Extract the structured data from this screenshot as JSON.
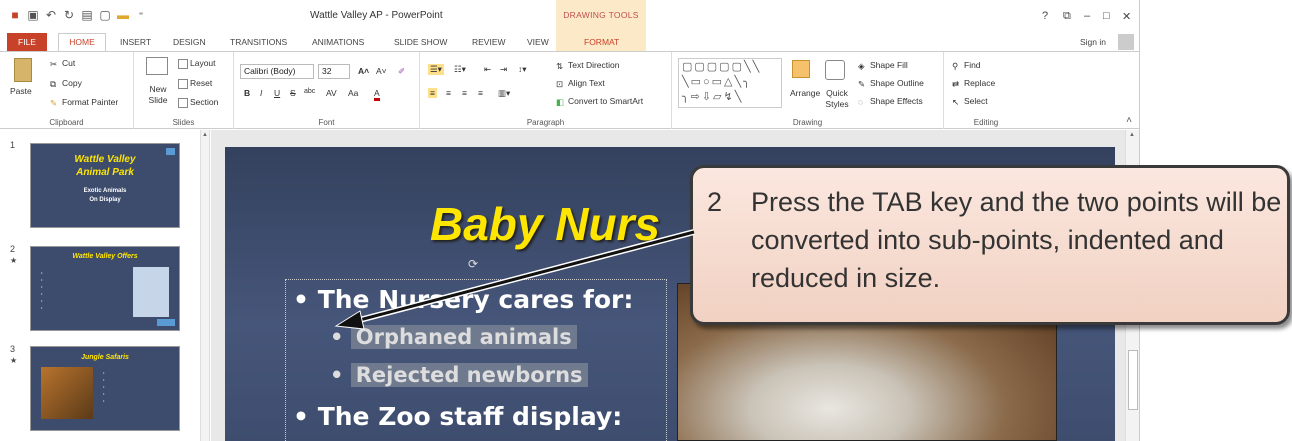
{
  "window": {
    "title": "Wattle Valley AP - PowerPoint",
    "context_header": "DRAWING TOOLS",
    "sign_in": "Sign in",
    "controls": {
      "help": "?",
      "restore": "⧉",
      "minimize": "–",
      "maximize": "□",
      "close": "✕"
    }
  },
  "tabs": [
    "FILE",
    "HOME",
    "INSERT",
    "DESIGN",
    "TRANSITIONS",
    "ANIMATIONS",
    "SLIDE SHOW",
    "REVIEW",
    "VIEW",
    "FORMAT"
  ],
  "ribbon": {
    "clipboard": {
      "paste": "Paste",
      "cut": "Cut",
      "copy": "Copy",
      "format_painter": "Format Painter",
      "label": "Clipboard"
    },
    "slides": {
      "new_slide": "New Slide",
      "layout": "Layout",
      "reset": "Reset",
      "section": "Section",
      "label": "Slides"
    },
    "font": {
      "font_name": "Calibri (Body)",
      "font_size": "32",
      "label": "Font"
    },
    "paragraph": {
      "text_direction": "Text Direction",
      "align_text": "Align Text",
      "convert_smartart": "Convert to SmartArt",
      "label": "Paragraph"
    },
    "drawing": {
      "arrange": "Arrange",
      "quick_styles": "Quick Styles",
      "shape_fill": "Shape Fill",
      "shape_outline": "Shape Outline",
      "shape_effects": "Shape Effects",
      "label": "Drawing"
    },
    "editing": {
      "find": "Find",
      "replace": "Replace",
      "select": "Select",
      "label": "Editing"
    }
  },
  "thumbnails": [
    {
      "num": "1",
      "title": "Wattle Valley",
      "title2": "Animal Park",
      "sub": "Exotic Animals",
      "sub2": "On Display"
    },
    {
      "num": "2",
      "title": "Wattle Valley Offers"
    },
    {
      "num": "3",
      "title": "Jungle Safaris"
    }
  ],
  "slide": {
    "title": "Baby Nurs",
    "bullets": [
      {
        "level": 1,
        "text": "The Nursery cares for:"
      },
      {
        "level": 2,
        "text": "Orphaned animals"
      },
      {
        "level": 2,
        "text": "Rejected newborns"
      },
      {
        "level": 1,
        "text": "The Zoo staff display:"
      }
    ]
  },
  "callout": {
    "number": "2",
    "text": "Press the TAB key and the two points will be converted into sub-points, indented and reduced in size."
  },
  "colors": {
    "file_tab": "#c8422a",
    "slide_bg": "#3d4c6d",
    "title_yellow": "#ffe600",
    "callout_bg": "#f1d1c2"
  }
}
